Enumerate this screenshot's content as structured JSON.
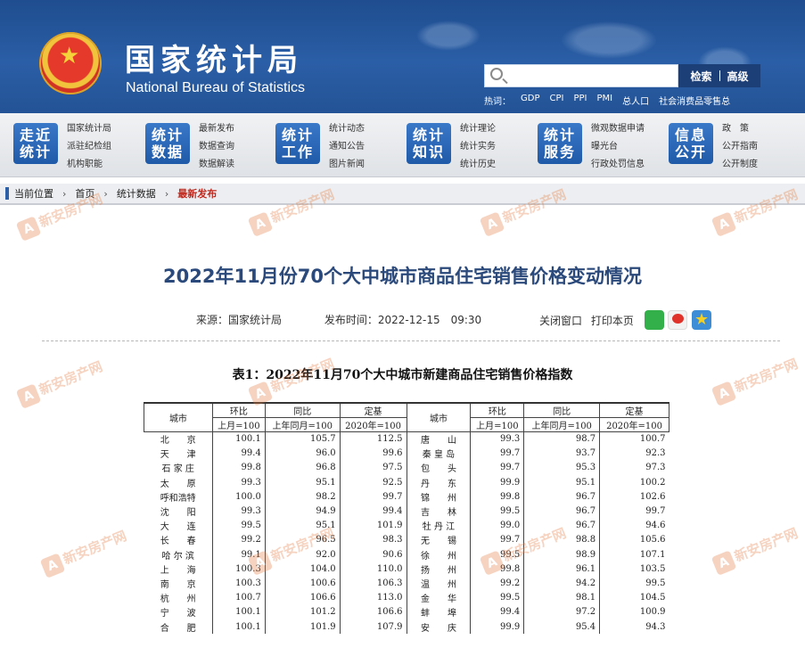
{
  "header": {
    "logo_cn": "国家统计局",
    "logo_en": "National Bureau of Statistics",
    "search_placeholder": "",
    "search_label": "检索",
    "advanced_label": "高级",
    "hot_label": "热词：",
    "hot_words": [
      "GDP",
      "CPI",
      "PPI",
      "PMI",
      "总人口",
      "社会消费品零售总"
    ]
  },
  "nav": [
    {
      "badge": "走近统计",
      "links": [
        "国家统计局",
        "派驻纪检组",
        "机构职能"
      ]
    },
    {
      "badge": "统计数据",
      "links": [
        "最新发布",
        "数据查询",
        "数据解读"
      ]
    },
    {
      "badge": "统计工作",
      "links": [
        "统计动态",
        "通知公告",
        "图片新闻"
      ]
    },
    {
      "badge": "统计知识",
      "links": [
        "统计理论",
        "统计实务",
        "统计历史"
      ]
    },
    {
      "badge": "统计服务",
      "links": [
        "微观数据申请",
        "曝光台",
        "行政处罚信息"
      ]
    },
    {
      "badge": "信息公开",
      "links": [
        "政　策",
        "公开指南",
        "公开制度"
      ]
    }
  ],
  "breadcrumb": {
    "label": "当前位置",
    "items": [
      "首页",
      "统计数据"
    ],
    "current": "最新发布",
    "sep": "›"
  },
  "article": {
    "title": "2022年11月份70个大中城市商品住宅销售价格变动情况",
    "source": "来源：国家统计局",
    "time": "发布时间：2022-12-15　09:30",
    "close_label": "关闭窗口",
    "print_label": "打印本页"
  },
  "table": {
    "title": "表1：2022年11月70个大中城市新建商品住宅销售价格指数",
    "col_city": "城市",
    "col_mom": "环比",
    "col_yoy": "同比",
    "col_base": "定基",
    "sub_mom": "上月=100",
    "sub_yoy": "上年同月=100",
    "sub_base": "2020年=100",
    "rows": [
      [
        [
          "北　　京",
          "100.1",
          "105.7",
          "112.5"
        ],
        [
          "唐　　山",
          "99.3",
          "98.7",
          "100.7"
        ]
      ],
      [
        [
          "天　　津",
          "99.4",
          "96.0",
          "99.6"
        ],
        [
          "秦 皇 岛",
          "99.7",
          "93.7",
          "92.3"
        ]
      ],
      [
        [
          "石 家 庄",
          "99.8",
          "96.8",
          "97.5"
        ],
        [
          "包　　头",
          "99.7",
          "95.3",
          "97.3"
        ]
      ],
      [
        [
          "太　　原",
          "99.3",
          "95.1",
          "92.5"
        ],
        [
          "丹　　东",
          "99.9",
          "95.1",
          "100.2"
        ]
      ],
      [
        [
          "呼和浩特",
          "100.0",
          "98.2",
          "99.7"
        ],
        [
          "锦　　州",
          "99.8",
          "96.7",
          "102.6"
        ]
      ],
      [
        [
          "沈　　阳",
          "99.3",
          "94.9",
          "99.4"
        ],
        [
          "吉　　林",
          "99.5",
          "96.7",
          "99.7"
        ]
      ],
      [
        [
          "大　　连",
          "99.5",
          "95.1",
          "101.9"
        ],
        [
          "牡 丹 江",
          "99.0",
          "96.7",
          "94.6"
        ]
      ],
      [
        [
          "长　　春",
          "99.2",
          "96.5",
          "98.3"
        ],
        [
          "无　　锡",
          "99.7",
          "98.8",
          "105.6"
        ]
      ],
      [
        [
          "哈 尔 滨",
          "99.1",
          "92.0",
          "90.6"
        ],
        [
          "徐　　州",
          "99.5",
          "98.9",
          "107.1"
        ]
      ],
      [
        [
          "上　　海",
          "100.3",
          "104.0",
          "110.0"
        ],
        [
          "扬　　州",
          "99.8",
          "96.1",
          "103.5"
        ]
      ],
      [
        [
          "南　　京",
          "100.3",
          "100.6",
          "106.3"
        ],
        [
          "温　　州",
          "99.2",
          "94.2",
          "99.5"
        ]
      ],
      [
        [
          "杭　　州",
          "100.7",
          "106.6",
          "113.0"
        ],
        [
          "金　　华",
          "99.5",
          "98.1",
          "104.5"
        ]
      ],
      [
        [
          "宁　　波",
          "100.1",
          "101.2",
          "106.6"
        ],
        [
          "蚌　　埠",
          "99.4",
          "97.2",
          "100.9"
        ]
      ],
      [
        [
          "合　　肥",
          "100.1",
          "101.9",
          "107.9"
        ],
        [
          "安　　庆",
          "99.9",
          "95.4",
          "94.3"
        ]
      ]
    ]
  },
  "watermark": "新安房产网"
}
